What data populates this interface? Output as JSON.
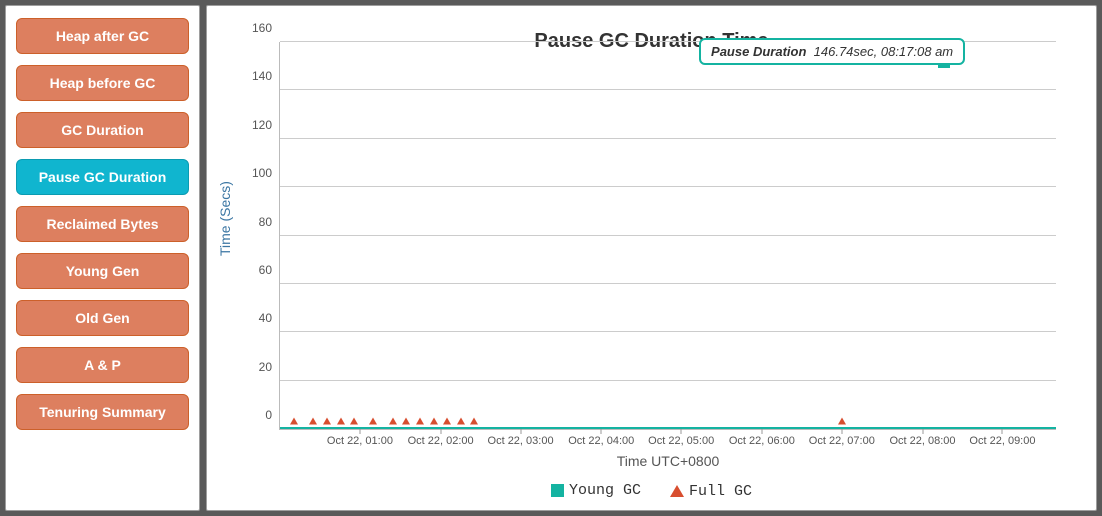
{
  "sidebar": {
    "items": [
      {
        "label": "Heap after GC",
        "active": false
      },
      {
        "label": "Heap before GC",
        "active": false
      },
      {
        "label": "GC Duration",
        "active": false
      },
      {
        "label": "Pause GC Duration",
        "active": true
      },
      {
        "label": "Reclaimed Bytes",
        "active": false
      },
      {
        "label": "Young Gen",
        "active": false
      },
      {
        "label": "Old Gen",
        "active": false
      },
      {
        "label": "A & P",
        "active": false
      },
      {
        "label": "Tenuring Summary",
        "active": false
      }
    ]
  },
  "chart": {
    "title": "Pause GC Duration Time",
    "ylabel": "Time (Secs)",
    "xlabel": "Time UTC+0800",
    "tooltip_label": "Pause Duration",
    "tooltip_value": "146.74sec, 08:17:08 am",
    "legend": [
      {
        "name": "Young GC",
        "color": "#14b3a1",
        "shape": "square"
      },
      {
        "name": "Full GC",
        "color": "#d84e2f",
        "shape": "triangle"
      }
    ]
  },
  "chart_data": {
    "type": "scatter",
    "title": "Pause GC Duration Time",
    "xlabel": "Time UTC+0800",
    "ylabel": "Time (Secs)",
    "ylim": [
      0,
      160
    ],
    "xticks": [
      "Oct 22, 01:00",
      "Oct 22, 02:00",
      "Oct 22, 03:00",
      "Oct 22, 04:00",
      "Oct 22, 05:00",
      "Oct 22, 06:00",
      "Oct 22, 07:00",
      "Oct 22, 08:00",
      "Oct 22, 09:00"
    ],
    "yticks": [
      0,
      20,
      40,
      60,
      80,
      100,
      120,
      140,
      160
    ],
    "series": [
      {
        "name": "Young GC",
        "color": "#14b3a1",
        "points": [
          {
            "x": "Oct 22, 08:17:08",
            "y": 146.74
          }
        ]
      },
      {
        "name": "Full GC",
        "color": "#d84e2f",
        "points": [
          {
            "x": "Oct 22, 00:10",
            "y": 0.5
          },
          {
            "x": "Oct 22, 00:25",
            "y": 0.5
          },
          {
            "x": "Oct 22, 00:35",
            "y": 0.5
          },
          {
            "x": "Oct 22, 00:45",
            "y": 0.5
          },
          {
            "x": "Oct 22, 00:55",
            "y": 0.5
          },
          {
            "x": "Oct 22, 01:10",
            "y": 0.5
          },
          {
            "x": "Oct 22, 01:25",
            "y": 0.5
          },
          {
            "x": "Oct 22, 01:35",
            "y": 0.5
          },
          {
            "x": "Oct 22, 01:45",
            "y": 0.5
          },
          {
            "x": "Oct 22, 01:55",
            "y": 0.5
          },
          {
            "x": "Oct 22, 02:05",
            "y": 0.5
          },
          {
            "x": "Oct 22, 02:15",
            "y": 0.5
          },
          {
            "x": "Oct 22, 02:25",
            "y": 0.5
          },
          {
            "x": "Oct 22, 07:00",
            "y": 0.5
          }
        ]
      }
    ],
    "highlight": {
      "series": "Young GC",
      "x": "Oct 22, 08:17:08",
      "y": 146.74,
      "label": "Pause Duration 146.74sec, 08:17:08 am"
    }
  }
}
